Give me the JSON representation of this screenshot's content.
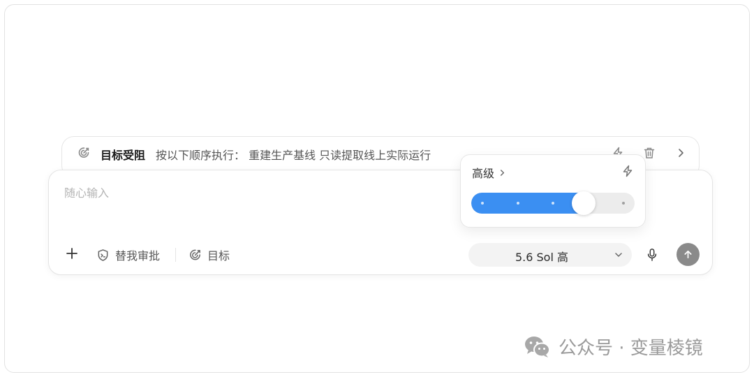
{
  "goal_banner": {
    "title": "目标受阻",
    "text": "按以下顺序执行： 重建生产基线 只读提取线上实际运行"
  },
  "composer": {
    "placeholder": "随心输入",
    "value": "",
    "approve_label": "替我审批",
    "goal_label": "目标",
    "model_label": "5.6 Sol 高"
  },
  "popover": {
    "title": "高级",
    "level_fraction": 0.72,
    "steps": 5
  },
  "watermark": {
    "text": "公众号 · 变量棱镜"
  },
  "colors": {
    "accent": "#3b8ff2",
    "send_button": "#8a8a8a",
    "muted_text": "#555555"
  },
  "icons": {
    "goal": "target-icon",
    "lightning": "lightning-icon",
    "trash": "trash-icon",
    "chevron": "chevron-right-icon",
    "add": "plus-icon",
    "approve": "shield-icon",
    "mic": "microphone-icon",
    "send": "arrow-up-icon"
  }
}
